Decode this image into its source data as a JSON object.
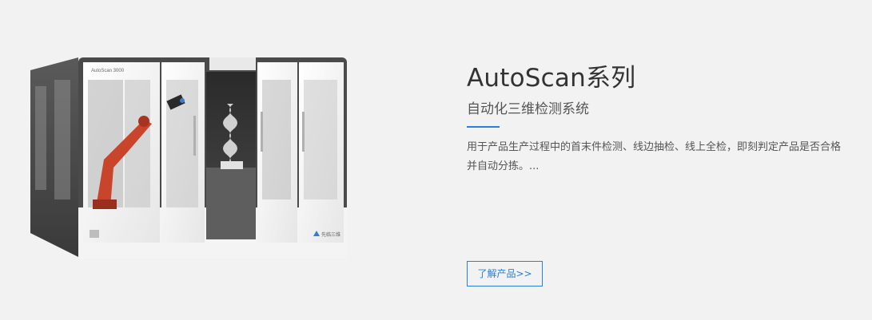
{
  "product": {
    "title": "AutoScan系列",
    "subtitle": "自动化三维检测系统",
    "description": "用于产品生产过程中的首末件检测、线边抽检、线上全检，即刻判定产品是否合格并自动分拣。...",
    "more_button": "了解产品>>"
  },
  "image": {
    "machine_label": "AutoScan 3000",
    "brand_label": "先临三维"
  },
  "colors": {
    "background": "#f2f2f2",
    "accent": "#2b7fd6",
    "title": "#333333",
    "text": "#555555"
  }
}
